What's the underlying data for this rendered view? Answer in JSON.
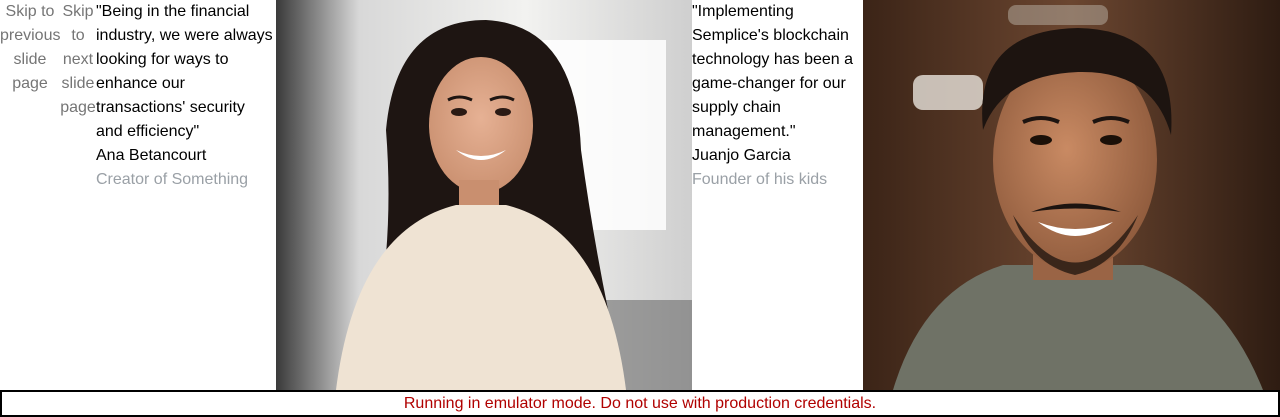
{
  "nav": {
    "skip_previous": "Skip to previous slide page",
    "skip_next": "Skip to next slide page"
  },
  "testimonials": [
    {
      "quote": "\"Being in the financial industry, we were always looking for ways to enhance our transactions' security and efficiency\"",
      "author": "Ana Betancourt",
      "role": "Creator of Something"
    },
    {
      "quote": "\"Implementing Semplice's blockchain technology has been a game-changer for our supply chain management.\"",
      "author": "Juanjo Garcia",
      "role": "Founder of his kids"
    }
  ],
  "banner": {
    "text": "Running in emulator mode. Do not use with production credentials.",
    "color": "#b00000"
  }
}
